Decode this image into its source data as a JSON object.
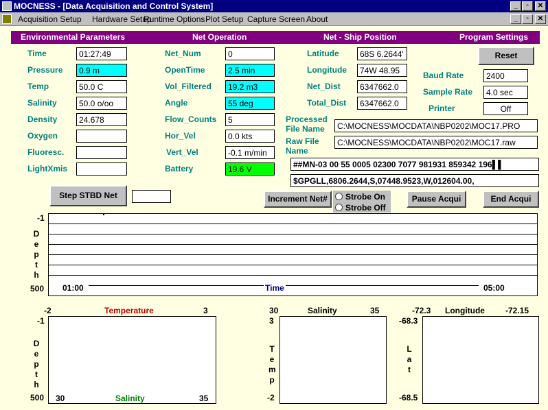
{
  "title": "MOCNESS - [Data Acquisition and Control System]",
  "window_buttons": [
    "_",
    "▫",
    "✕"
  ],
  "menu": [
    "Acquisition Setup",
    "Hardware Setup",
    "Runtime Options",
    "Plot Setup",
    "Capture Screen",
    "About"
  ],
  "sections": [
    "Environmental Parameters",
    "Net Operation",
    "Net - Ship Position",
    "Program Settings"
  ],
  "env": [
    {
      "label": "Time",
      "value": "01:27:49"
    },
    {
      "label": "Pressure",
      "value": "0.9 m"
    },
    {
      "label": "Temp",
      "value": "50.0 C"
    },
    {
      "label": "Salinity",
      "value": "50.0 o/oo"
    },
    {
      "label": "Density",
      "value": "24.678"
    },
    {
      "label": "Oxygen",
      "value": ""
    },
    {
      "label": "Fluoresc.",
      "value": ""
    },
    {
      "label": "LightXmis",
      "value": ""
    }
  ],
  "net": [
    {
      "label": "Net_Num",
      "value": "0"
    },
    {
      "label": "OpenTime",
      "value": "2.5 min"
    },
    {
      "label": "Vol_Filtered",
      "value": "19.2 m3"
    },
    {
      "label": "Angle",
      "value": "55 deg"
    },
    {
      "label": "Flow_Counts",
      "value": "5"
    },
    {
      "label": "Hor_Vel",
      "value": "0.0 kts"
    },
    {
      "label": "Vert_Vel",
      "value": "-0.1 m/min"
    },
    {
      "label": "Battery",
      "value": "19.6 V"
    }
  ],
  "position": [
    {
      "label": "Latitude",
      "value": "68S 6.2644'"
    },
    {
      "label": "Longitude",
      "value": "74W 48.95"
    },
    {
      "label": "Net_Dist",
      "value": "6347662.0"
    },
    {
      "label": "Total_Dist",
      "value": "6347662.0"
    }
  ],
  "settings": {
    "reset": "Reset",
    "baud_label": "Baud Rate",
    "baud": "2400",
    "sample_label": "Sample Rate",
    "sample": "4.0 sec",
    "printer_label": "Printer",
    "printer": "Off"
  },
  "files": {
    "processed_label": "Processed\nFile Name",
    "processed": "C:\\MOCNESS\\MOCDATA\\NBP0202\\MOC17.PRO",
    "raw_label": "Raw File\nName",
    "raw": "C:\\MOCNESS\\MOCDATA\\NBP0202\\MOC17.raw",
    "line1": "##MN-03 00 55 0005 02300 7077 981931 859342 196",
    "line1_tail": "▌▌",
    "line2": "$GPGLL,6806.2644,S,07448.9523,W,012604.00,"
  },
  "buttons": {
    "step": "Step STBD Net",
    "step_value": "",
    "increment": "Increment Net#",
    "strobe_on": "Strobe On",
    "strobe_off": "Strobe Off",
    "pause": "Pause Acqui",
    "end": "End Acqui"
  },
  "depth_plot": {
    "ymin": "-1",
    "ymax": "500",
    "ylabel": "Depth",
    "tstart": "01:00",
    "tend": "05:00",
    "tlabel": "Time"
  },
  "temp_plot": {
    "xmin": "-2",
    "xmax": "3",
    "xlabel": "Temperature",
    "ymin": "-1",
    "ymax": "500",
    "ylabel": "Depth",
    "x2min": "30",
    "x2max": "35",
    "x2label": "Salinity"
  },
  "ts_plot": {
    "xmin": "30",
    "xmax": "35",
    "xlabel": "Salinity",
    "ymin": "3",
    "ymax": "-2",
    "ylabel": "Temp"
  },
  "ll_plot": {
    "xmin": "-72.3",
    "xmax": "-72.15",
    "xlabel": "Longitude",
    "ymin": "-68.3",
    "ymax": "-68.5",
    "ylabel": "Lat"
  }
}
